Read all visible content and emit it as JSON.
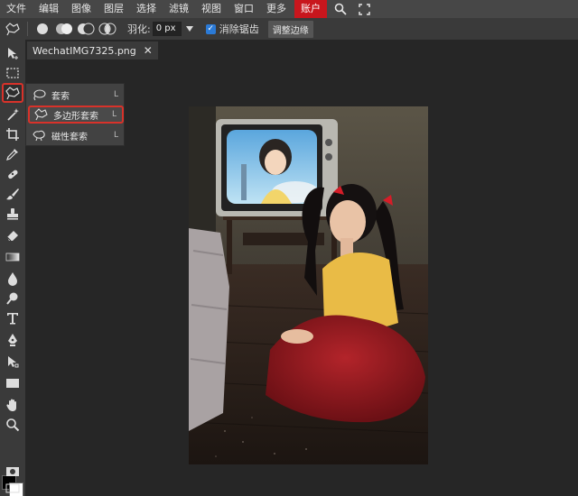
{
  "menubar": {
    "items": [
      "文件",
      "编辑",
      "图像",
      "图层",
      "选择",
      "滤镜",
      "视图",
      "窗口",
      "更多"
    ],
    "account": "账户",
    "account_color": "#c8161d",
    "icons": [
      "search-icon",
      "fullscreen-icon"
    ]
  },
  "options": {
    "feather_label": "羽化:",
    "feather_value": "0 px",
    "antialias_label": "消除锯齿",
    "antialias_checked": true,
    "refine_label": "调整边缘"
  },
  "tab": {
    "filename": "WechatIMG7325.png",
    "close": "✕"
  },
  "flyout": {
    "items": [
      {
        "label": "套索",
        "key": "L",
        "icon": "lasso-icon"
      },
      {
        "label": "多边形套索",
        "key": "L",
        "icon": "polygonal-lasso-icon",
        "selected": true
      },
      {
        "label": "磁性套索",
        "key": "L",
        "icon": "magnetic-lasso-icon"
      }
    ]
  },
  "toolbar": {
    "tools": [
      "move-icon",
      "marquee-icon",
      "lasso-icon",
      "magic-wand-icon",
      "crop-icon",
      "eyedropper-icon",
      "healing-icon",
      "brush-icon",
      "stamp-icon",
      "eraser-icon",
      "gradient-icon",
      "blur-icon",
      "dodge-icon",
      "text-icon",
      "pen-icon",
      "path-select-icon",
      "shape-icon",
      "hand-icon",
      "zoom-icon"
    ],
    "active_tool": "lasso-icon",
    "foreground_color": "#000000",
    "background_color": "#ffffff"
  },
  "accent_color": "#d8322a"
}
